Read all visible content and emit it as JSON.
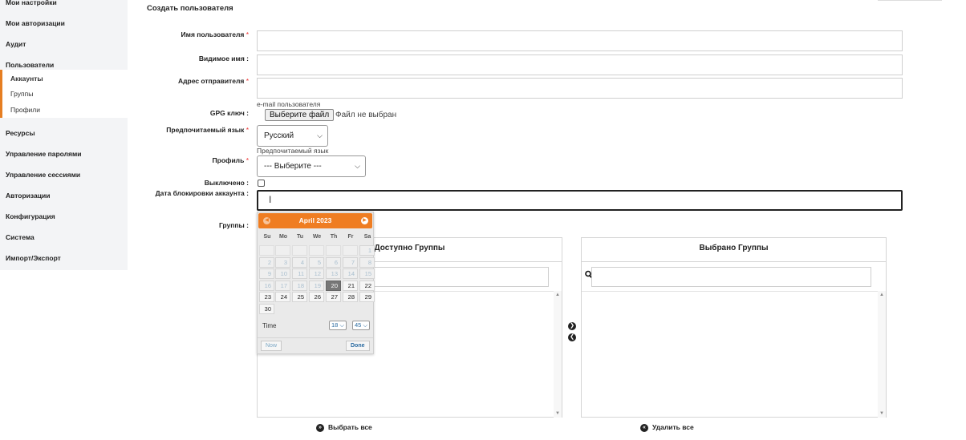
{
  "sidebar": {
    "items": [
      {
        "label": "Мои настройки"
      },
      {
        "label": "Мои авторизации"
      },
      {
        "label": "Аудит"
      },
      {
        "label": "Пользователи"
      },
      {
        "label": "Ресурсы"
      },
      {
        "label": "Управление паролями"
      },
      {
        "label": "Управление сессиями"
      },
      {
        "label": "Авторизации"
      },
      {
        "label": "Конфигурация"
      },
      {
        "label": "Система"
      },
      {
        "label": "Импорт/Экспорт"
      }
    ],
    "subitems": [
      {
        "label": "Аккаунты",
        "active": true
      },
      {
        "label": "Группы"
      },
      {
        "label": "Профили"
      }
    ],
    "accent_color": "#e67e22"
  },
  "form": {
    "title": "Создать пользователя",
    "username_label": "Имя пользователя",
    "display_name_label": "Видимое имя",
    "sender_label": "Адрес отправителя",
    "sender_hint": "e-mail пользователя",
    "gpg_label": "GPG ключ",
    "file_button": "Выберите файл",
    "file_status": "Файл не выбран",
    "language_label": "Предпочитаемый язык",
    "language_value": "Русский",
    "language_hint": "Предпочитаемый язык",
    "profile_label": "Профиль",
    "profile_value": "--- Выберите ---",
    "disabled_label": "Выключено",
    "lock_date_label": "Дата блокировки аккаунта",
    "groups_label": "Группы",
    "required_mark": "*",
    "colon": ":"
  },
  "groups": {
    "available_title": "Доступно Группы",
    "selected_title": "Выбрано Группы",
    "select_all": "Выбрать все",
    "remove_all": "Удалить все"
  },
  "datepicker": {
    "month_title": "April 2023",
    "weekdays": [
      "Su",
      "Mo",
      "Tu",
      "We",
      "Th",
      "Fr",
      "Sa"
    ],
    "weeks": [
      [
        "",
        "",
        "",
        "",
        "",
        "",
        "1"
      ],
      [
        "2",
        "3",
        "4",
        "5",
        "6",
        "7",
        "8"
      ],
      [
        "9",
        "10",
        "11",
        "12",
        "13",
        "14",
        "15"
      ],
      [
        "16",
        "17",
        "18",
        "19",
        "20",
        "21",
        "22"
      ],
      [
        "23",
        "24",
        "25",
        "26",
        "27",
        "28",
        "29"
      ],
      [
        "30",
        "",
        "",
        "",
        "",
        "",
        ""
      ]
    ],
    "today": "20",
    "first_enabled": 20,
    "time_label": "Time",
    "hour": "18",
    "minute": "45",
    "now_button": "Now",
    "done_button": "Done",
    "header_color": "#ef7d22"
  }
}
